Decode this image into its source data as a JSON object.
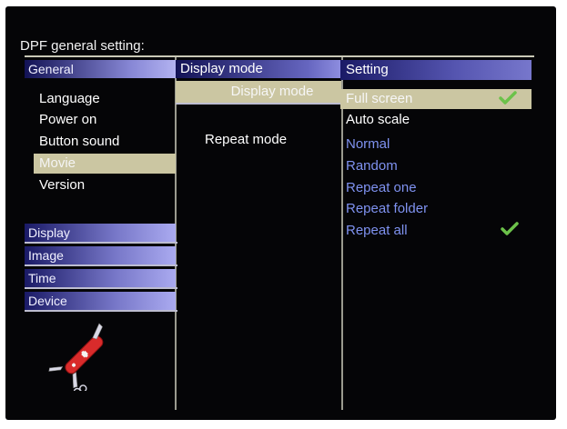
{
  "title": "DPF general setting:",
  "left": {
    "general_label": "General",
    "items": [
      "Language",
      "Power on",
      "Button sound",
      "Movie",
      "Version"
    ],
    "selected_index": 3,
    "categories": [
      "Display",
      "Image",
      "Time",
      "Device"
    ]
  },
  "middle": {
    "header": "Display mode",
    "selected_item": "Display mode",
    "other_item": "Repeat mode"
  },
  "right": {
    "header": "Setting",
    "display_options": [
      "Full screen",
      "Auto scale"
    ],
    "repeat_options": [
      "Normal",
      "Random",
      "Repeat one",
      "Repeat folder",
      "Repeat all"
    ],
    "display_checked": "Full screen",
    "repeat_checked": "Repeat all"
  },
  "colors": {
    "background": "#050507",
    "selection": "#cbc6a2",
    "option_blue": "#7f92f0",
    "check_green": "#6cc24a"
  },
  "icons": [
    "checkmark-icon",
    "swiss-knife-icon"
  ]
}
